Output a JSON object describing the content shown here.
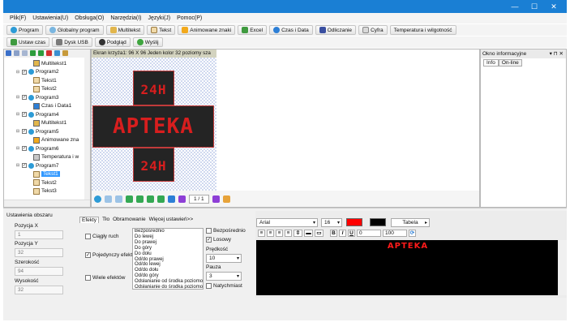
{
  "window": {
    "minimize": "—",
    "maximize": "☐",
    "close": "✕"
  },
  "menu": [
    "Plik(F)",
    "Ustawienia(U)",
    "Obsługa(O)",
    "Narzędzia(I)",
    "Języki(J)",
    "Pomoc(P)"
  ],
  "toolbar1": [
    "Program",
    "Globalny program",
    "Multitekst",
    "Tekst",
    "Animowane znaki",
    "Excel",
    "Czas i Data",
    "Odliczanie",
    "Cyfra",
    "Temperatura i wilgotność"
  ],
  "toolbar2": [
    "Ustaw czas",
    "Dysk USB",
    "Podgląd",
    "Wyślij"
  ],
  "tree": [
    {
      "label": "Multitekst1",
      "indent": 3,
      "type": "multi"
    },
    {
      "label": "Program2",
      "indent": 1,
      "type": "program"
    },
    {
      "label": "Tekst1",
      "indent": 3,
      "type": "text"
    },
    {
      "label": "Tekst2",
      "indent": 3,
      "type": "text"
    },
    {
      "label": "Program3",
      "indent": 1,
      "type": "program"
    },
    {
      "label": "Czas i Data1",
      "indent": 3,
      "type": "clock"
    },
    {
      "label": "Program4",
      "indent": 1,
      "type": "program"
    },
    {
      "label": "Multitekst1",
      "indent": 3,
      "type": "multi"
    },
    {
      "label": "Program5",
      "indent": 1,
      "type": "program"
    },
    {
      "label": "Animowane zna",
      "indent": 3,
      "type": "anim"
    },
    {
      "label": "Program6",
      "indent": 1,
      "type": "program"
    },
    {
      "label": "Temperatura i w",
      "indent": 3,
      "type": "temp"
    },
    {
      "label": "Program7",
      "indent": 1,
      "type": "program"
    },
    {
      "label": "Tekst1",
      "indent": 3,
      "type": "text",
      "selected": true
    },
    {
      "label": "Tekst2",
      "indent": 3,
      "type": "text"
    },
    {
      "label": "Tekst3",
      "indent": 3,
      "type": "text"
    }
  ],
  "canvas": {
    "header": "Ekran krzyża1: 96 X 96  Jeden kolor 32 poziomy sza",
    "top_text": "24H",
    "middle_text": "APTEKA",
    "bottom_text": "24H",
    "page_indicator": "1 / 1"
  },
  "info_panel": {
    "title": "Okno informacyjne",
    "controls": "▾ ⊓ ✕",
    "tabs": [
      "Info",
      "On-line"
    ]
  },
  "area": {
    "title": "Ustawienia obszaru",
    "pos_x_label": "Pozycja X",
    "pos_x": "1",
    "pos_y_label": "Pozycja Y",
    "pos_y": "32",
    "width_label": "Szerokość",
    "width": "94",
    "height_label": "Wysokość",
    "height": "32"
  },
  "tabs": [
    "Efekty",
    "Tło",
    "Obramowanie",
    "Więcej ustawień>>"
  ],
  "effects": {
    "continuous": "Ciągły ruch",
    "single": "Pojedynczy efekt",
    "multi": "Wiele efektów",
    "list": [
      "Bezpośrednio",
      "Do lewej",
      "Do prawej",
      "Do góry",
      "Do dołu",
      "Od/do prawej",
      "Od/do lewej",
      "Od/do dołu",
      "Od/do góry",
      "Odsłanianie od środka poziomo",
      "Odsłanianie do środka poziomo"
    ],
    "direct": "Bezpośrednio",
    "random": "Losowy",
    "speed_label": "Prędkość",
    "speed": "10",
    "pause_label": "Pauza",
    "pause": "3",
    "immediate": "Natychmiast"
  },
  "text_editor": {
    "font": "Arial",
    "size": "16",
    "color": "#ff0000",
    "bg_color": "#000000",
    "table_label": "Tabela",
    "spacing": "0",
    "scale": "100",
    "preview_text": "APTEKA"
  }
}
